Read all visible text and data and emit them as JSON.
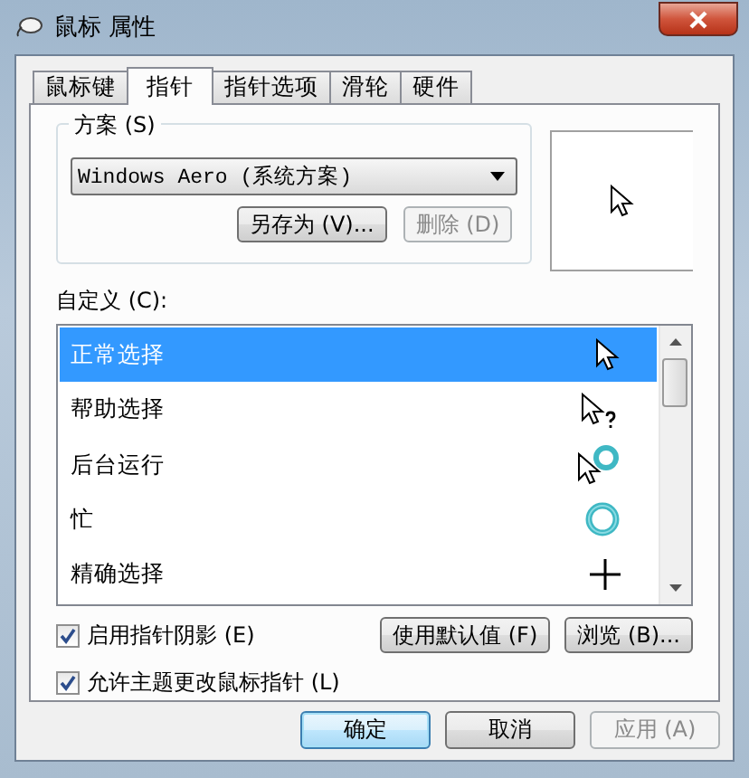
{
  "window": {
    "title": "鼠标 属性"
  },
  "tabs": [
    {
      "label": "鼠标键",
      "selected": false
    },
    {
      "label": "指针",
      "selected": true
    },
    {
      "label": "指针选项",
      "selected": false
    },
    {
      "label": "滑轮",
      "selected": false
    },
    {
      "label": "硬件",
      "selected": false
    }
  ],
  "scheme": {
    "group_label": "方案 (S)",
    "value": "Windows Aero (系统方案)",
    "save_as": {
      "label": "另存为 (V)...",
      "disabled": false
    },
    "delete": {
      "label": "删除 (D)",
      "disabled": true
    }
  },
  "customize": {
    "label": "自定义 (C):",
    "items": [
      {
        "label": "正常选择",
        "kind": "arrow",
        "selected": true
      },
      {
        "label": "帮助选择",
        "kind": "help",
        "selected": false
      },
      {
        "label": "后台运行",
        "kind": "working",
        "selected": false
      },
      {
        "label": "忙",
        "kind": "busy",
        "selected": false
      },
      {
        "label": "精确选择",
        "kind": "precision",
        "selected": false
      }
    ]
  },
  "options": [
    {
      "label": "启用指针阴影 (E)",
      "checked": true
    },
    {
      "label": "允许主题更改鼠标指针 (L)",
      "checked": true
    }
  ],
  "list_buttons": [
    {
      "label": "使用默认值 (F)",
      "disabled": false
    },
    {
      "label": "浏览 (B)...",
      "disabled": false
    }
  ],
  "footer_buttons": [
    {
      "label": "确定",
      "default": true,
      "disabled": false
    },
    {
      "label": "取消",
      "default": false,
      "disabled": false
    },
    {
      "label": "应用 (A)",
      "default": false,
      "disabled": true
    }
  ]
}
